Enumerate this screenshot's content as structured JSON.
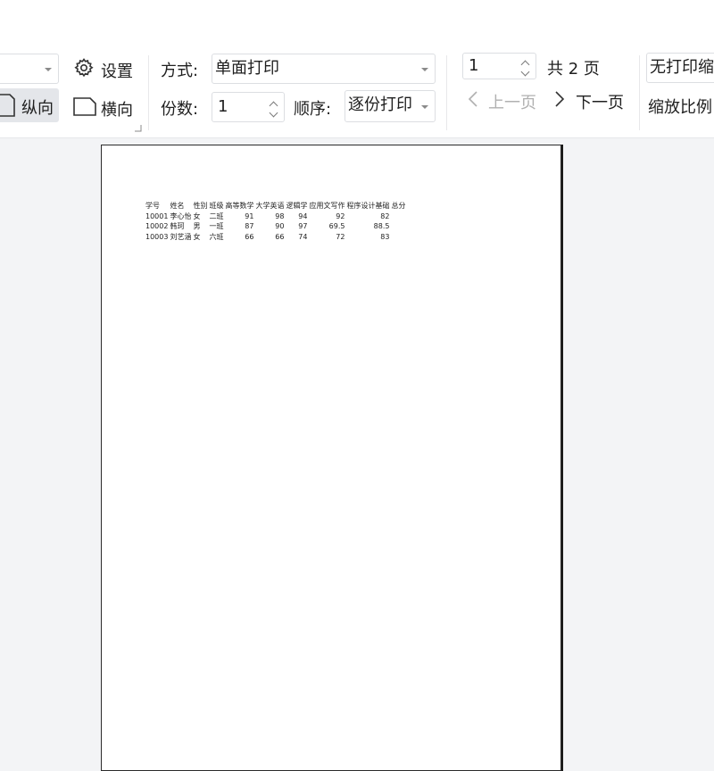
{
  "toolbar": {
    "settings_label": "设置",
    "orientation": {
      "portrait_label": "纵向",
      "landscape_label": "横向",
      "selected": "纵向"
    },
    "mode": {
      "label": "方式:",
      "value": "单面打印"
    },
    "copies": {
      "label": "份数:",
      "value": "1"
    },
    "order": {
      "label": "顺序:",
      "value": "逐份打印"
    },
    "page_input": {
      "value": "1"
    },
    "total_pages": "共 2 页",
    "prev_label": "上一页",
    "next_label": "下一页",
    "scale": {
      "value": "无打印缩",
      "label": "缩放比例"
    }
  },
  "sheet": {
    "headers": [
      "学号",
      "姓名",
      "性别",
      "班级",
      "高等数学",
      "大学英语",
      "逻辑学",
      "应用文写作",
      "程序设计基础",
      "总分"
    ],
    "rows": [
      [
        "10001",
        "李心怡",
        "女",
        "二班",
        "91",
        "98",
        "94",
        "92",
        "82",
        ""
      ],
      [
        "10002",
        "韩珂",
        "男",
        "一班",
        "87",
        "90",
        "97",
        "69.5",
        "88.5",
        ""
      ],
      [
        "10003",
        "刘艺涵",
        "女",
        "六班",
        "66",
        "66",
        "74",
        "72",
        "83",
        ""
      ]
    ]
  },
  "colors": {
    "accent_selected_bg": "#e4e6ea",
    "ribbon_bg": "#ffffff",
    "preview_bg": "#f3f4f6"
  },
  "icons": [
    "gear-icon",
    "portrait-page-icon",
    "landscape-page-icon",
    "chevron-left-icon",
    "chevron-right-icon",
    "dialog-launcher-icon"
  ]
}
